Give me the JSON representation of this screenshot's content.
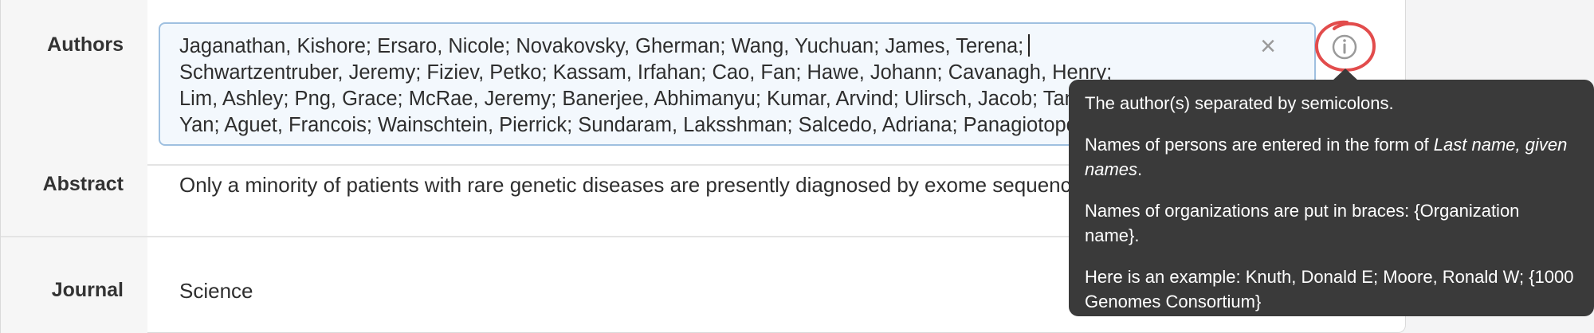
{
  "fields": {
    "authors": {
      "label": "Authors",
      "lines": [
        "Jaganathan, Kishore; Ersaro, Nicole; Novakovsky, Gherman; Wang, Yuchuan; James, Terena;",
        "Schwartzentruber, Jeremy; Fiziev, Petko; Kassam, Irfahan; Cao, Fan; Hawe, Johann; Cavanagh, Henry;",
        "Lim, Ashley; Png, Grace; McRae, Jeremy; Banerjee, Abhimanyu; Kumar, Arvind; Ulirsch, Jacob; Tan,",
        "Yan; Aguet, Francois; Wainschtein, Pierrick; Sundaram, Laksshman; Salcedo, Adriana; Panagiotopoulou,"
      ]
    },
    "abstract": {
      "label": "Abstract",
      "value": "Only a minority of patients with rare genetic diseases are presently diagnosed by exome sequencing"
    },
    "journal": {
      "label": "Journal",
      "value": "Science"
    }
  },
  "controls": {
    "clear_glyph": "×",
    "info_glyph": "i"
  },
  "tooltip": {
    "p1": "The author(s) separated by semicolons.",
    "p2_prefix": "Names of persons are entered in the form of ",
    "p2_emph": "Last name, given names",
    "p2_suffix": ".",
    "p3": "Names of organizations are put in braces: {Organization name}.",
    "p4": "Here is an example: Knuth, Donald E; Moore, Ronald W; {1000 Genomes Consortium}"
  },
  "colors": {
    "annotation_circle": "#e24c4c",
    "tooltip_bg": "#3a3a3a",
    "input_border": "#9fc0e0"
  }
}
